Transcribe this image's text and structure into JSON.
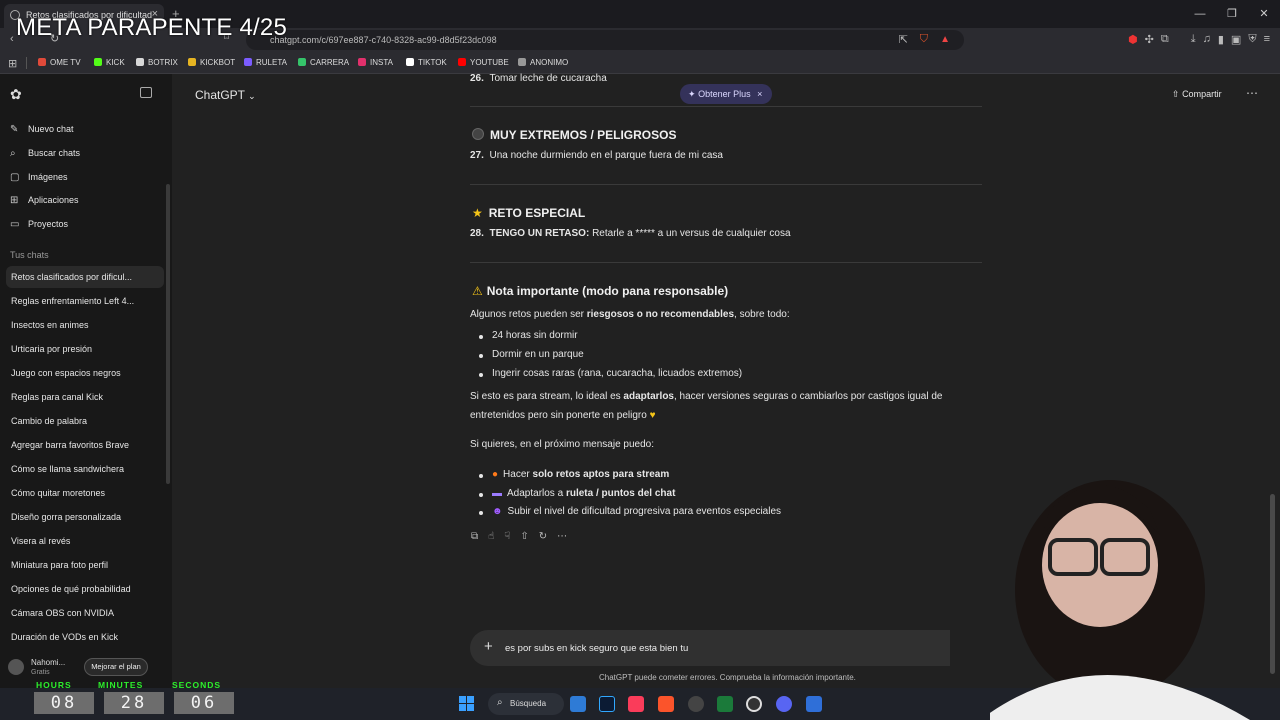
{
  "overlay_title": "META PARAPENTE 4/25",
  "browser": {
    "tab_title": "Retos clasificados por dificultad",
    "url": "chatgpt.com/c/697ee887-c740-8328-ac99-d8d5f23dc098",
    "bookmarks": [
      "OME TV",
      "KICK",
      "BOTRIX",
      "KICKBOT",
      "RULETA",
      "CARRERA",
      "INSTA",
      "TIKTOK",
      "YOUTUBE",
      "ANONIMO"
    ],
    "bookmark_colors": [
      "#e04a3a",
      "#53fc18",
      "#d8d8d8",
      "#e6b422",
      "#7b5cff",
      "#35c46a",
      "#e1306c",
      "#ffffff",
      "#ff0000",
      "#999999"
    ]
  },
  "sidebar": {
    "nav": [
      {
        "label": "Nuevo chat",
        "icon": "new-chat-icon"
      },
      {
        "label": "Buscar chats",
        "icon": "search-icon"
      },
      {
        "label": "Imágenes",
        "icon": "image-icon"
      },
      {
        "label": "Aplicaciones",
        "icon": "apps-icon"
      },
      {
        "label": "Proyectos",
        "icon": "folder-icon"
      }
    ],
    "section_label": "Tus chats",
    "chats": [
      "Retos clasificados por dificul...",
      "Reglas enfrentamiento Left 4...",
      "Insectos en animes",
      "Urticaria por presión",
      "Juego con espacios negros",
      "Reglas para canal Kick",
      "Cambio de palabra",
      "Agregar barra favoritos Brave",
      "Cómo se llama sandwichera",
      "Cómo quitar moretones",
      "Diseño gorra personalizada",
      "Visera al revés",
      "Miniatura para foto perfil",
      "Opciones de qué probabilidad",
      "Cámara OBS con NVIDIA",
      "Duración de VODs en Kick"
    ],
    "user_name": "Nahomi...",
    "user_plan": "Gratis",
    "upgrade_label": "Mejorar el plan"
  },
  "header": {
    "title": "ChatGPT",
    "plus_label": "Obtener Plus",
    "share_label": "Compartir"
  },
  "content": {
    "item26_num": "26.",
    "item26_text": "Tomar leche de cucaracha",
    "sec_extreme": "MUY EXTREMOS / PELIGROSOS",
    "item27_num": "27.",
    "item27_text": "Una noche durmiendo en el parque fuera de mi casa",
    "sec_special": "RETO ESPECIAL",
    "item28_num": "28.",
    "item28_bold": "TENGO UN RETASO:",
    "item28_text": "Retarle a ***** a un versus de cualquier cosa",
    "note_title": "Nota importante (modo pana responsable)",
    "note_intro_a": "Algunos retos pueden ser",
    "note_intro_b": "riesgosos o no recomendables",
    "note_intro_c": ", sobre todo:",
    "risk_list": [
      "24 horas sin dormir",
      "Dormir en un parque",
      "Ingerir cosas raras (rana, cucaracha, licuados extremos)"
    ],
    "stream_a": "Si esto es para stream, lo ideal es",
    "stream_b": "adaptarlos",
    "stream_c": ", hacer versiones seguras o cambiarlos por castigos igual de",
    "stream_d": "entretenidos pero sin ponerte en peligro",
    "next_intro": "Si quieres, en el próximo mensaje puedo:",
    "opt1_a": "Hacer",
    "opt1_b": "solo retos aptos para stream",
    "opt2_a": "Adaptarlos a",
    "opt2_b": "ruleta / puntos del chat",
    "opt3": "Subir el nivel de dificultad progresiva para eventos especiales"
  },
  "composer": {
    "text": "es por subs en kick seguro que esta bien tu"
  },
  "disclaimer": "ChatGPT puede cometer errores. Comprueba la información importante.",
  "timer": {
    "hours_label": "HOURS",
    "minutes_label": "MINUTES",
    "seconds_label": "SECONDS",
    "hours": "08",
    "minutes": "28",
    "seconds": "06"
  },
  "taskbar": {
    "search_label": "Búsqueda"
  }
}
